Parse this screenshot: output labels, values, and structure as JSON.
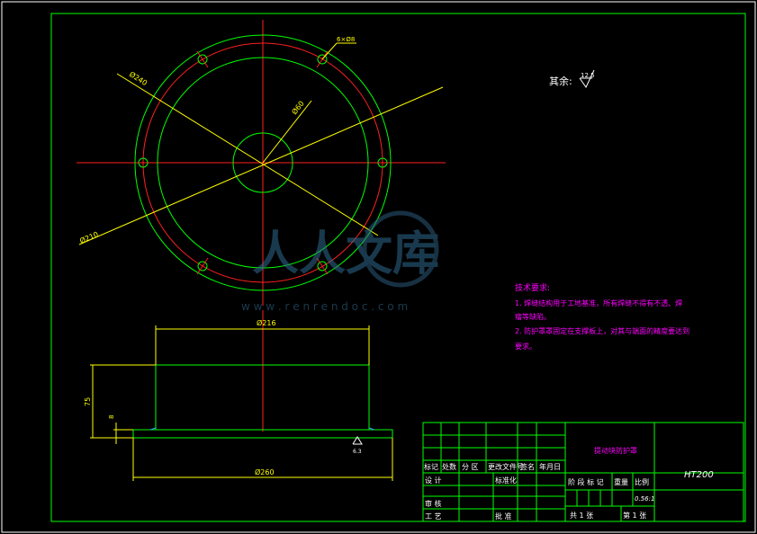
{
  "drawing": {
    "surface_roughness": {
      "prefix": "其余:",
      "value": "12.5"
    },
    "top_view_dims": {
      "outer_dia": "Ø240",
      "bolt_holes": "6×Ø8",
      "inner_dia": "Ø60",
      "bolt_circle": "Ø210"
    },
    "side_view_dims": {
      "top_width": "Ø216",
      "height": "75",
      "base_thickness": "8",
      "base_width": "Ø260",
      "roughness": "6.3"
    },
    "tech_requirements": {
      "title": "技术要求:",
      "line1": "1. 焊缝结构用于工地基准，所有焊缝不得有不透、焊",
      "line2": "瘤等缺陷。",
      "line3": "2. 防护罩罩固定在支撑板上，对其与端面的精度要达到",
      "line4": "要求。"
    },
    "watermark": {
      "text": "人人文库",
      "url": "w w w . r e n r e n d o c . c o m"
    }
  },
  "title_block": {
    "part_name": "提动块防护罩",
    "material": "HT200",
    "h_mark": "标记",
    "h_count": "处数",
    "h_zone": "分 区",
    "h_change": "更改文件号",
    "h_sign": "签名",
    "h_date": "年月日",
    "designer": "设 计",
    "standardize": "标准化",
    "reviewer": "审 核",
    "process": "工 艺",
    "approve": "批 准",
    "stage_mark": "阶 段 标 记",
    "weight": "重量",
    "scale_label": "比例",
    "scale_value": "0.56:1",
    "sheets_total": "共 1 张",
    "sheet_no": "第 1 张"
  },
  "colors": {
    "border": "#00ff00",
    "center": "#ff2020",
    "dim": "#ffff00",
    "text_magenta": "#ff00ff",
    "white": "#ffffff",
    "blue": "#3399ff"
  }
}
